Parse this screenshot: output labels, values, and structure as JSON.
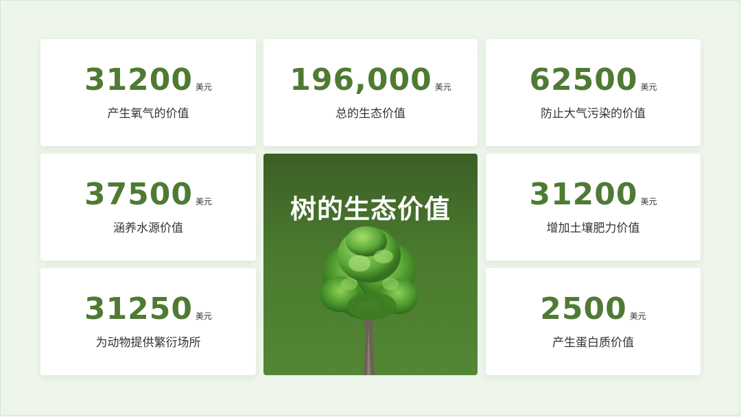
{
  "cards": [
    {
      "value": "31200",
      "unit": "美元",
      "label": "产生氧气的价值"
    },
    {
      "value": "196,000",
      "unit": "美元",
      "label": "总的生态价值"
    },
    {
      "value": "62500",
      "unit": "美元",
      "label": "防止大气污染的价值"
    },
    {
      "value": "37500",
      "unit": "美元",
      "label": "涵养水源价值"
    },
    {
      "value": "31200",
      "unit": "美元",
      "label": "增加土壤肥力价值"
    },
    {
      "value": "31250",
      "unit": "美元",
      "label": "为动物提供繁衍场所"
    },
    {
      "value": "2500",
      "unit": "美元",
      "label": "产生蛋白质价值"
    }
  ],
  "center": {
    "title": "树的生态价值"
  },
  "colors": {
    "accent": "#4f7a33",
    "background": "#eef5ea",
    "panel": "#4a7a2e"
  },
  "icons": {
    "center_image": "tree-icon"
  }
}
